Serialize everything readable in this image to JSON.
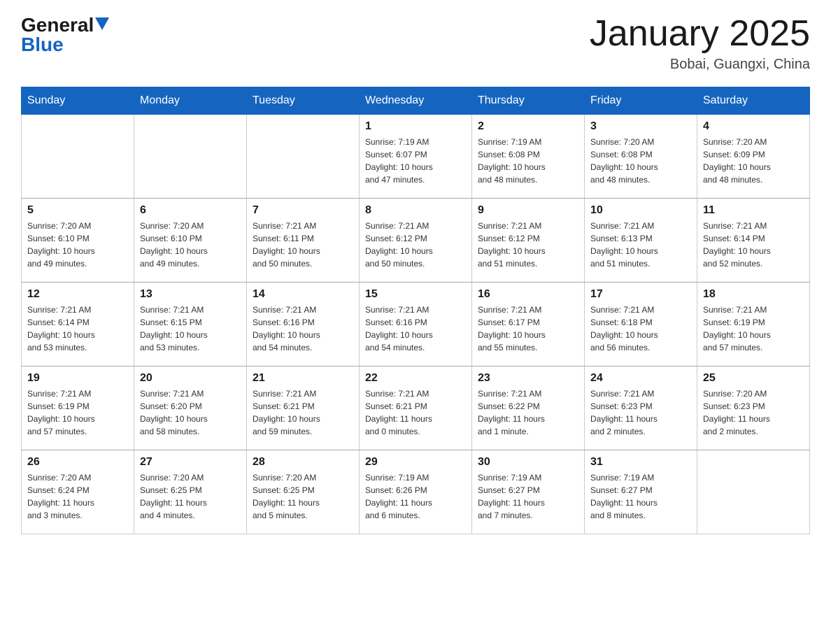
{
  "header": {
    "logo_general": "General",
    "logo_blue": "Blue",
    "month_title": "January 2025",
    "location": "Bobai, Guangxi, China"
  },
  "weekdays": [
    "Sunday",
    "Monday",
    "Tuesday",
    "Wednesday",
    "Thursday",
    "Friday",
    "Saturday"
  ],
  "weeks": [
    [
      {
        "day": "",
        "info": ""
      },
      {
        "day": "",
        "info": ""
      },
      {
        "day": "",
        "info": ""
      },
      {
        "day": "1",
        "info": "Sunrise: 7:19 AM\nSunset: 6:07 PM\nDaylight: 10 hours\nand 47 minutes."
      },
      {
        "day": "2",
        "info": "Sunrise: 7:19 AM\nSunset: 6:08 PM\nDaylight: 10 hours\nand 48 minutes."
      },
      {
        "day": "3",
        "info": "Sunrise: 7:20 AM\nSunset: 6:08 PM\nDaylight: 10 hours\nand 48 minutes."
      },
      {
        "day": "4",
        "info": "Sunrise: 7:20 AM\nSunset: 6:09 PM\nDaylight: 10 hours\nand 48 minutes."
      }
    ],
    [
      {
        "day": "5",
        "info": "Sunrise: 7:20 AM\nSunset: 6:10 PM\nDaylight: 10 hours\nand 49 minutes."
      },
      {
        "day": "6",
        "info": "Sunrise: 7:20 AM\nSunset: 6:10 PM\nDaylight: 10 hours\nand 49 minutes."
      },
      {
        "day": "7",
        "info": "Sunrise: 7:21 AM\nSunset: 6:11 PM\nDaylight: 10 hours\nand 50 minutes."
      },
      {
        "day": "8",
        "info": "Sunrise: 7:21 AM\nSunset: 6:12 PM\nDaylight: 10 hours\nand 50 minutes."
      },
      {
        "day": "9",
        "info": "Sunrise: 7:21 AM\nSunset: 6:12 PM\nDaylight: 10 hours\nand 51 minutes."
      },
      {
        "day": "10",
        "info": "Sunrise: 7:21 AM\nSunset: 6:13 PM\nDaylight: 10 hours\nand 51 minutes."
      },
      {
        "day": "11",
        "info": "Sunrise: 7:21 AM\nSunset: 6:14 PM\nDaylight: 10 hours\nand 52 minutes."
      }
    ],
    [
      {
        "day": "12",
        "info": "Sunrise: 7:21 AM\nSunset: 6:14 PM\nDaylight: 10 hours\nand 53 minutes."
      },
      {
        "day": "13",
        "info": "Sunrise: 7:21 AM\nSunset: 6:15 PM\nDaylight: 10 hours\nand 53 minutes."
      },
      {
        "day": "14",
        "info": "Sunrise: 7:21 AM\nSunset: 6:16 PM\nDaylight: 10 hours\nand 54 minutes."
      },
      {
        "day": "15",
        "info": "Sunrise: 7:21 AM\nSunset: 6:16 PM\nDaylight: 10 hours\nand 54 minutes."
      },
      {
        "day": "16",
        "info": "Sunrise: 7:21 AM\nSunset: 6:17 PM\nDaylight: 10 hours\nand 55 minutes."
      },
      {
        "day": "17",
        "info": "Sunrise: 7:21 AM\nSunset: 6:18 PM\nDaylight: 10 hours\nand 56 minutes."
      },
      {
        "day": "18",
        "info": "Sunrise: 7:21 AM\nSunset: 6:19 PM\nDaylight: 10 hours\nand 57 minutes."
      }
    ],
    [
      {
        "day": "19",
        "info": "Sunrise: 7:21 AM\nSunset: 6:19 PM\nDaylight: 10 hours\nand 57 minutes."
      },
      {
        "day": "20",
        "info": "Sunrise: 7:21 AM\nSunset: 6:20 PM\nDaylight: 10 hours\nand 58 minutes."
      },
      {
        "day": "21",
        "info": "Sunrise: 7:21 AM\nSunset: 6:21 PM\nDaylight: 10 hours\nand 59 minutes."
      },
      {
        "day": "22",
        "info": "Sunrise: 7:21 AM\nSunset: 6:21 PM\nDaylight: 11 hours\nand 0 minutes."
      },
      {
        "day": "23",
        "info": "Sunrise: 7:21 AM\nSunset: 6:22 PM\nDaylight: 11 hours\nand 1 minute."
      },
      {
        "day": "24",
        "info": "Sunrise: 7:21 AM\nSunset: 6:23 PM\nDaylight: 11 hours\nand 2 minutes."
      },
      {
        "day": "25",
        "info": "Sunrise: 7:20 AM\nSunset: 6:23 PM\nDaylight: 11 hours\nand 2 minutes."
      }
    ],
    [
      {
        "day": "26",
        "info": "Sunrise: 7:20 AM\nSunset: 6:24 PM\nDaylight: 11 hours\nand 3 minutes."
      },
      {
        "day": "27",
        "info": "Sunrise: 7:20 AM\nSunset: 6:25 PM\nDaylight: 11 hours\nand 4 minutes."
      },
      {
        "day": "28",
        "info": "Sunrise: 7:20 AM\nSunset: 6:25 PM\nDaylight: 11 hours\nand 5 minutes."
      },
      {
        "day": "29",
        "info": "Sunrise: 7:19 AM\nSunset: 6:26 PM\nDaylight: 11 hours\nand 6 minutes."
      },
      {
        "day": "30",
        "info": "Sunrise: 7:19 AM\nSunset: 6:27 PM\nDaylight: 11 hours\nand 7 minutes."
      },
      {
        "day": "31",
        "info": "Sunrise: 7:19 AM\nSunset: 6:27 PM\nDaylight: 11 hours\nand 8 minutes."
      },
      {
        "day": "",
        "info": ""
      }
    ]
  ]
}
